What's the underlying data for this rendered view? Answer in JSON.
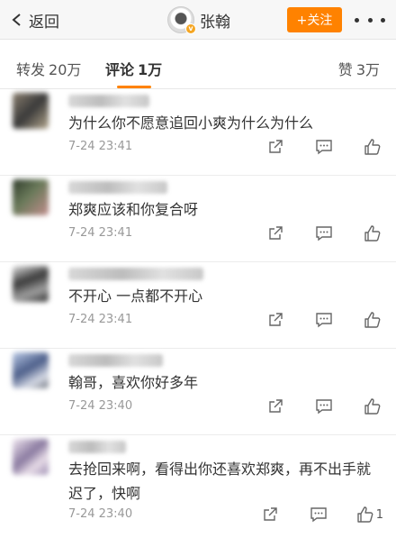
{
  "nav": {
    "back_label": "返回",
    "user_name": "张翰",
    "follow_label": "+关注"
  },
  "tabs": {
    "repost_label": "转发",
    "repost_count": "20万",
    "comment_label": "评论",
    "comment_count": "1万",
    "like_label": "赞",
    "like_count": "3万"
  },
  "colors": {
    "accent": "#ff8200",
    "text": "#333333",
    "muted": "#999999"
  },
  "comments": [
    {
      "text": "为什么你不愿意追回小爽为什么为什么",
      "time": "7-24 23:41",
      "like_count": ""
    },
    {
      "text": "郑爽应该和你复合呀",
      "time": "7-24 23:41",
      "like_count": ""
    },
    {
      "text": "不开心 一点都不开心",
      "time": "7-24 23:41",
      "like_count": ""
    },
    {
      "text": "翰哥，喜欢你好多年",
      "time": "7-24 23:40",
      "like_count": ""
    },
    {
      "text": "去抢回来啊，看得出你还喜欢郑爽，再不出手就迟了，快啊",
      "time": "7-24 23:40",
      "like_count": "1"
    }
  ],
  "icons": {
    "back": "chevron-left-icon",
    "more": "more-icon",
    "repost": "share-icon",
    "reply": "comment-icon",
    "like": "thumbs-up-icon"
  }
}
